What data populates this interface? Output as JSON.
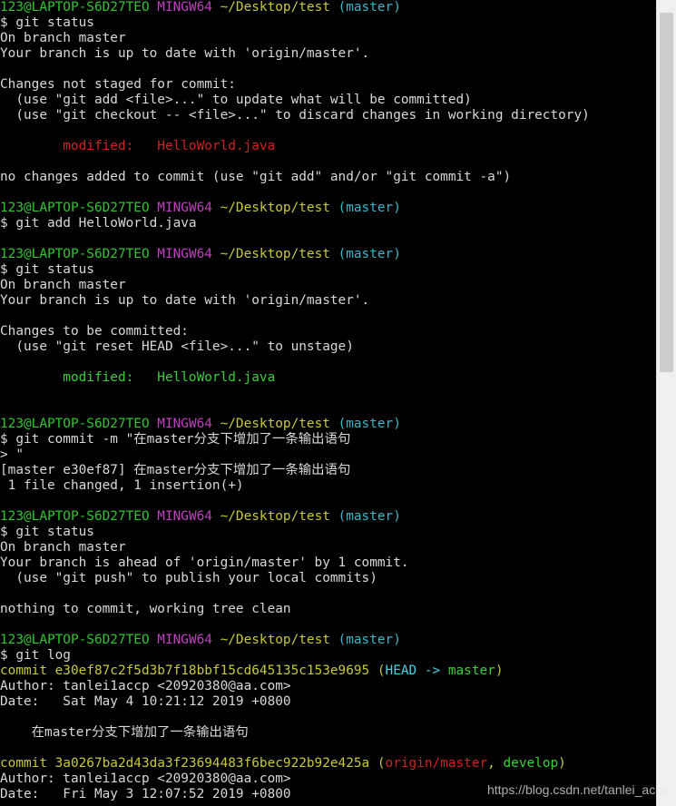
{
  "terminal": {
    "lines": [
      [
        [
          "123@LAPTOP-S6D27TEO",
          "green"
        ],
        [
          " MINGW64",
          "magenta"
        ],
        [
          " ~/Desktop/test",
          "yellow"
        ],
        [
          " (master)",
          "cyan"
        ]
      ],
      [
        [
          "$ git status",
          "default"
        ]
      ],
      [
        [
          "On branch master",
          "default"
        ]
      ],
      [
        [
          "Your branch is up to date with 'origin/master'.",
          "default"
        ]
      ],
      [],
      [
        [
          "Changes not staged for commit:",
          "default"
        ]
      ],
      [
        [
          "  (use \"git add <file>...\" to update what will be committed)",
          "default"
        ]
      ],
      [
        [
          "  (use \"git checkout -- <file>...\" to discard changes in working directory)",
          "default"
        ]
      ],
      [],
      [
        [
          "        modified:   HelloWorld.java",
          "red"
        ]
      ],
      [],
      [
        [
          "no changes added to commit (use \"git add\" and/or \"git commit -a\")",
          "default"
        ]
      ],
      [],
      [
        [
          "123@LAPTOP-S6D27TEO",
          "green"
        ],
        [
          " MINGW64",
          "magenta"
        ],
        [
          " ~/Desktop/test",
          "yellow"
        ],
        [
          " (master)",
          "cyan"
        ]
      ],
      [
        [
          "$ git add HelloWorld.java",
          "default"
        ]
      ],
      [],
      [
        [
          "123@LAPTOP-S6D27TEO",
          "green"
        ],
        [
          " MINGW64",
          "magenta"
        ],
        [
          " ~/Desktop/test",
          "yellow"
        ],
        [
          " (master)",
          "cyan"
        ]
      ],
      [
        [
          "$ git status",
          "default"
        ]
      ],
      [
        [
          "On branch master",
          "default"
        ]
      ],
      [
        [
          "Your branch is up to date with 'origin/master'.",
          "default"
        ]
      ],
      [],
      [
        [
          "Changes to be committed:",
          "default"
        ]
      ],
      [
        [
          "  (use \"git reset HEAD <file>...\" to unstage)",
          "default"
        ]
      ],
      [],
      [
        [
          "        modified:   HelloWorld.java",
          "greenb"
        ]
      ],
      [],
      [],
      [
        [
          "123@LAPTOP-S6D27TEO",
          "green"
        ],
        [
          " MINGW64",
          "magenta"
        ],
        [
          " ~/Desktop/test",
          "yellow"
        ],
        [
          " (master)",
          "cyan"
        ]
      ],
      [
        [
          "$ git commit -m \"在master分支下增加了一条输出语句",
          "default"
        ]
      ],
      [
        [
          "> \"",
          "default"
        ]
      ],
      [
        [
          "[master e30ef87] 在master分支下增加了一条输出语句",
          "default"
        ]
      ],
      [
        [
          " 1 file changed, 1 insertion(+)",
          "default"
        ]
      ],
      [],
      [
        [
          "123@LAPTOP-S6D27TEO",
          "green"
        ],
        [
          " MINGW64",
          "magenta"
        ],
        [
          " ~/Desktop/test",
          "yellow"
        ],
        [
          " (master)",
          "cyan"
        ]
      ],
      [
        [
          "$ git status",
          "default"
        ]
      ],
      [
        [
          "On branch master",
          "default"
        ]
      ],
      [
        [
          "Your branch is ahead of 'origin/master' by 1 commit.",
          "default"
        ]
      ],
      [
        [
          "  (use \"git push\" to publish your local commits)",
          "default"
        ]
      ],
      [],
      [
        [
          "nothing to commit, working tree clean",
          "default"
        ]
      ],
      [],
      [
        [
          "123@LAPTOP-S6D27TEO",
          "green"
        ],
        [
          " MINGW64",
          "magenta"
        ],
        [
          " ~/Desktop/test",
          "yellow"
        ],
        [
          " (master)",
          "cyan"
        ]
      ],
      [
        [
          "$ git log",
          "default"
        ]
      ],
      [
        [
          "commit e30ef87c2f5d3b7f18bbf15cd645135c153e9695",
          "yellow"
        ],
        [
          " (",
          "yellow"
        ],
        [
          "HEAD ->",
          "cyanb"
        ],
        [
          " master",
          "greenb"
        ],
        [
          ")",
          "yellow"
        ]
      ],
      [
        [
          "Author: tanlei1accp <20920380@aa.com>",
          "default"
        ]
      ],
      [
        [
          "Date:   Sat May 4 10:21:12 2019 +0800",
          "default"
        ]
      ],
      [],
      [
        [
          "    在master分支下增加了一条输出语句",
          "default"
        ]
      ],
      [],
      [
        [
          "commit 3a0267ba2d43da3f23694483f6bec922b92e425a",
          "yellow"
        ],
        [
          " (",
          "yellow"
        ],
        [
          "origin/master",
          "red"
        ],
        [
          ", ",
          "yellow"
        ],
        [
          "develop",
          "greenb"
        ],
        [
          ")",
          "yellow"
        ]
      ],
      [
        [
          "Author: tanlei1accp <20920380@aa.com>",
          "default"
        ]
      ],
      [
        [
          "Date:   Fri May 3 12:07:52 2019 +0800",
          "default"
        ]
      ]
    ]
  },
  "colors": {
    "background": "#000000",
    "default": "#d8d8d8",
    "green": "#2ec52e",
    "magenta": "#c13fc1",
    "yellow": "#c8c83a",
    "cyan": "#3ab5c8",
    "red": "#d02222"
  },
  "scrollbar": {
    "position_fraction": 0.0,
    "visible_fraction": 0.45
  },
  "watermark": "https://blog.csdn.net/tanlei_accp"
}
